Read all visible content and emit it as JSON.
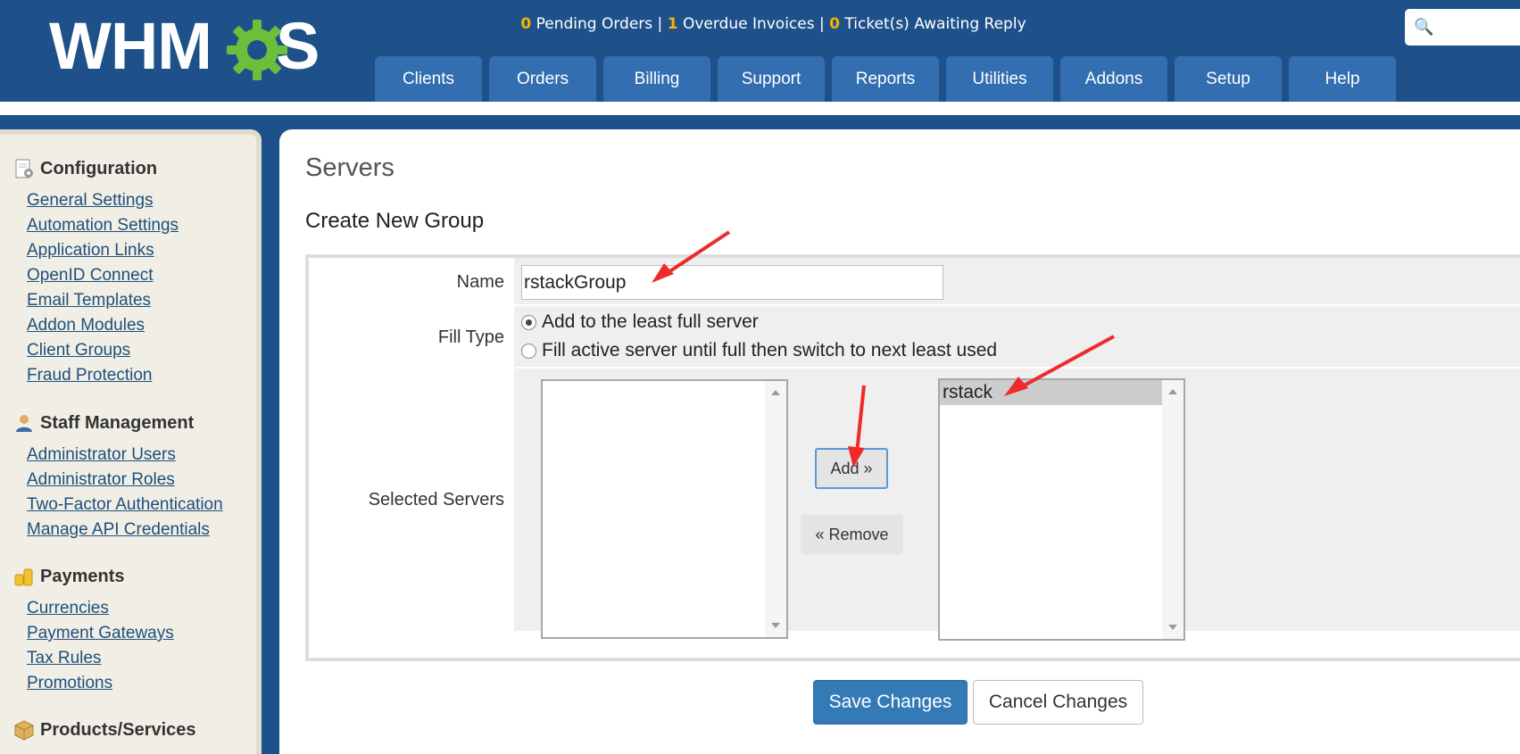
{
  "header": {
    "logo_text_pre": "WHM",
    "logo_text_post": "S",
    "status": {
      "pending_orders_count": "0",
      "pending_orders_label": "Pending Orders",
      "overdue_invoices_count": "1",
      "overdue_invoices_label": "Overdue Invoices",
      "tickets_count": "0",
      "tickets_label": "Ticket(s) Awaiting Reply",
      "separator": "|"
    },
    "search_icon": "search-icon",
    "nav_tabs": [
      "Clients",
      "Orders",
      "Billing",
      "Support",
      "Reports",
      "Utilities",
      "Addons",
      "Setup",
      "Help"
    ]
  },
  "sidebar": {
    "sections": [
      {
        "heading": "Configuration",
        "icon": "config-icon",
        "links": [
          "General Settings",
          "Automation Settings",
          "Application Links",
          "OpenID Connect",
          "Email Templates",
          "Addon Modules",
          "Client Groups",
          "Fraud Protection"
        ]
      },
      {
        "heading": "Staff Management",
        "icon": "staff-icon",
        "links": [
          "Administrator Users",
          "Administrator Roles",
          "Two-Factor Authentication",
          "Manage API Credentials"
        ]
      },
      {
        "heading": "Payments",
        "icon": "coins-icon",
        "links": [
          "Currencies",
          "Payment Gateways",
          "Tax Rules",
          "Promotions"
        ]
      },
      {
        "heading": "Products/Services",
        "icon": "box-icon",
        "links": []
      }
    ]
  },
  "main": {
    "page_title": "Servers",
    "section_title": "Create New Group",
    "form": {
      "name_label": "Name",
      "name_value": "rstackGroup",
      "fill_type_label": "Fill Type",
      "fill_options": [
        "Add to the least full server",
        "Fill active server until full then switch to next least used"
      ],
      "fill_selected_index": 0,
      "selected_servers_label": "Selected Servers",
      "available_servers": [],
      "selected_servers": [
        "rstack"
      ],
      "add_button": "Add »",
      "remove_button": "« Remove"
    },
    "save_button": "Save Changes",
    "cancel_button": "Cancel Changes"
  },
  "colors": {
    "header_bg": "#1e5189",
    "nav_tab_bg": "#336eb1",
    "status_count": "#f5b400",
    "logo_gear": "#6bbf3a",
    "primary_button": "#337ab7",
    "annotation_arrow": "#ee2b2b"
  }
}
